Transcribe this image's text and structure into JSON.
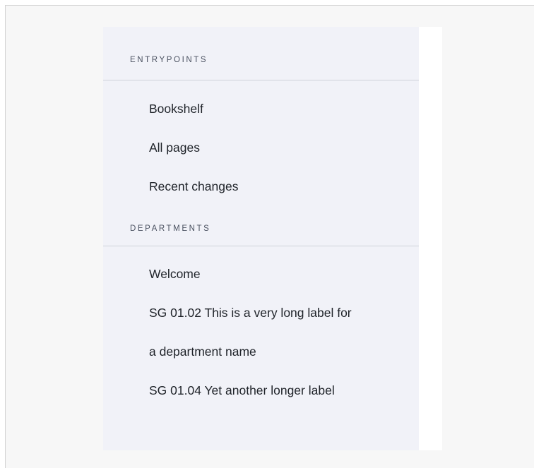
{
  "sidebar": {
    "sections": [
      {
        "heading": "ENTRYPOINTS",
        "items": [
          {
            "label": "Bookshelf"
          },
          {
            "label": "All pages"
          },
          {
            "label": "Recent changes"
          }
        ]
      },
      {
        "heading": "DEPARTMENTS",
        "items": [
          {
            "label": "Welcome"
          },
          {
            "label_line1": "SG 01.02 This is a very long label for",
            "label_line2": "a department name"
          },
          {
            "label": "SG 01.04 Yet another longer label"
          }
        ]
      }
    ]
  },
  "colors": {
    "sidebar_bg": "#f1f2f8",
    "page_bg": "#f7f7f7",
    "divider": "#cfd2da",
    "text": "#1f2329",
    "heading_text": "#4a5160"
  }
}
